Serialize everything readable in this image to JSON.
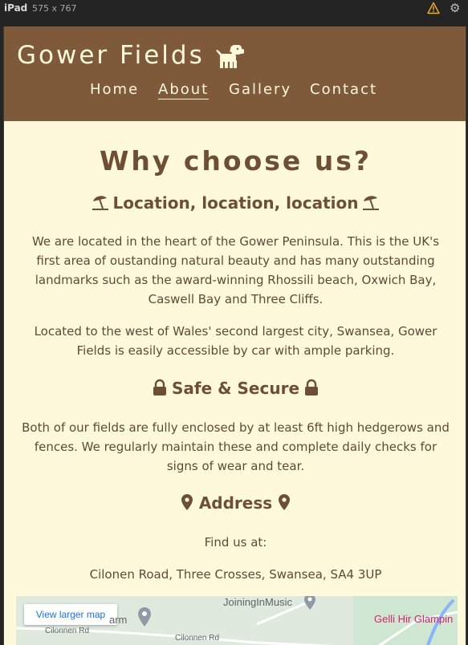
{
  "devtools": {
    "device": "iPad",
    "dimensions": "575 x 767",
    "warning_icon": "warning-icon",
    "settings_icon": "gear-icon"
  },
  "header": {
    "brand": "Gower Fields",
    "brand_icon": "dog-icon",
    "nav": [
      {
        "label": "Home",
        "active": false
      },
      {
        "label": "About",
        "active": true
      },
      {
        "label": "Gallery",
        "active": false
      },
      {
        "label": "Contact",
        "active": false
      }
    ]
  },
  "content": {
    "title": "Why choose us?",
    "location": {
      "heading": "Location, location, location",
      "icon": "umbrella-beach-icon",
      "paragraph1": "We are located in the heart of the Gower Peninsula. This is the UK's first area of oustanding natural beauty and has many outstanding landmarks such as the award-winning Rhossili beach, Oxwich Bay, Caswell Bay and Three Cliffs.",
      "paragraph2": "Located to the west of Wales' second largest city, Swansea, Gower Fields is easily accessible by car with ample parking."
    },
    "safe": {
      "heading": "Safe & Secure",
      "icon": "lock-icon",
      "paragraph": "Both of our fields are fully enclosed by at least 6ft high hedgerows and fences. We regularly maintain these and complete daily checks for signs of wear and tear."
    },
    "address": {
      "heading": "Address",
      "icon": "map-pin-icon",
      "find_us": "Find us at:",
      "address_line": "Cilonen Road, Three Crosses, Swansea, SA4 3UP"
    },
    "map": {
      "button": "View larger map",
      "place1": "JoiningInMusic",
      "place2": "arm",
      "place3": "Gelli Hir Glampin",
      "road1": "Cilonnen Rd",
      "road2": "Cilonnen Rd"
    }
  },
  "colors": {
    "header_bg": "#7e5a3a",
    "page_bg": "#fff9dc",
    "text_brown": "#6d4f33"
  }
}
